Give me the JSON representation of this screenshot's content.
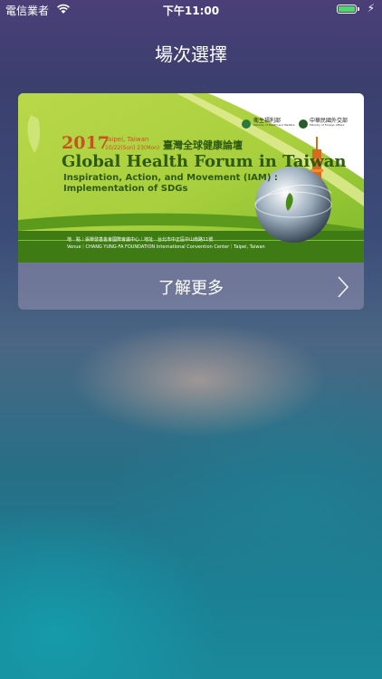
{
  "status_bar": {
    "carrier": "電信業者",
    "time": "下午11:00"
  },
  "nav": {
    "title": "場次選擇"
  },
  "banner": {
    "year": "2017",
    "location": "Taipei, Taiwan",
    "dates": "10/22(Sun) 23(Mon)",
    "title_zh": "臺灣全球健康論壇",
    "title_en": "Global Health Forum in Taiwan",
    "subtitle_line1": "Inspiration, Action, and Movement (IAM) :",
    "subtitle_line2": "Implementation of SDGs",
    "org1_zh": "衛生福利部",
    "org1_en": "Ministry of Health and Welfare",
    "org2_zh": "中華民國外交部",
    "org2_en": "Ministry of Foreign Affairs",
    "venue_line1": "地　點｜張榮發基金會國際會議中心｜地址　台北市中正區中山南路11號",
    "venue_line2": "Venue｜CHANG YUNG-FA FOUNDATION International Convention Center｜Taipei, Taiwan"
  },
  "card": {
    "more_label": "了解更多"
  },
  "colors": {
    "accent_green": "#7bb92a",
    "title_green": "#2e5a12",
    "year_orange": "#c1571d",
    "battery": "#4cd964"
  }
}
